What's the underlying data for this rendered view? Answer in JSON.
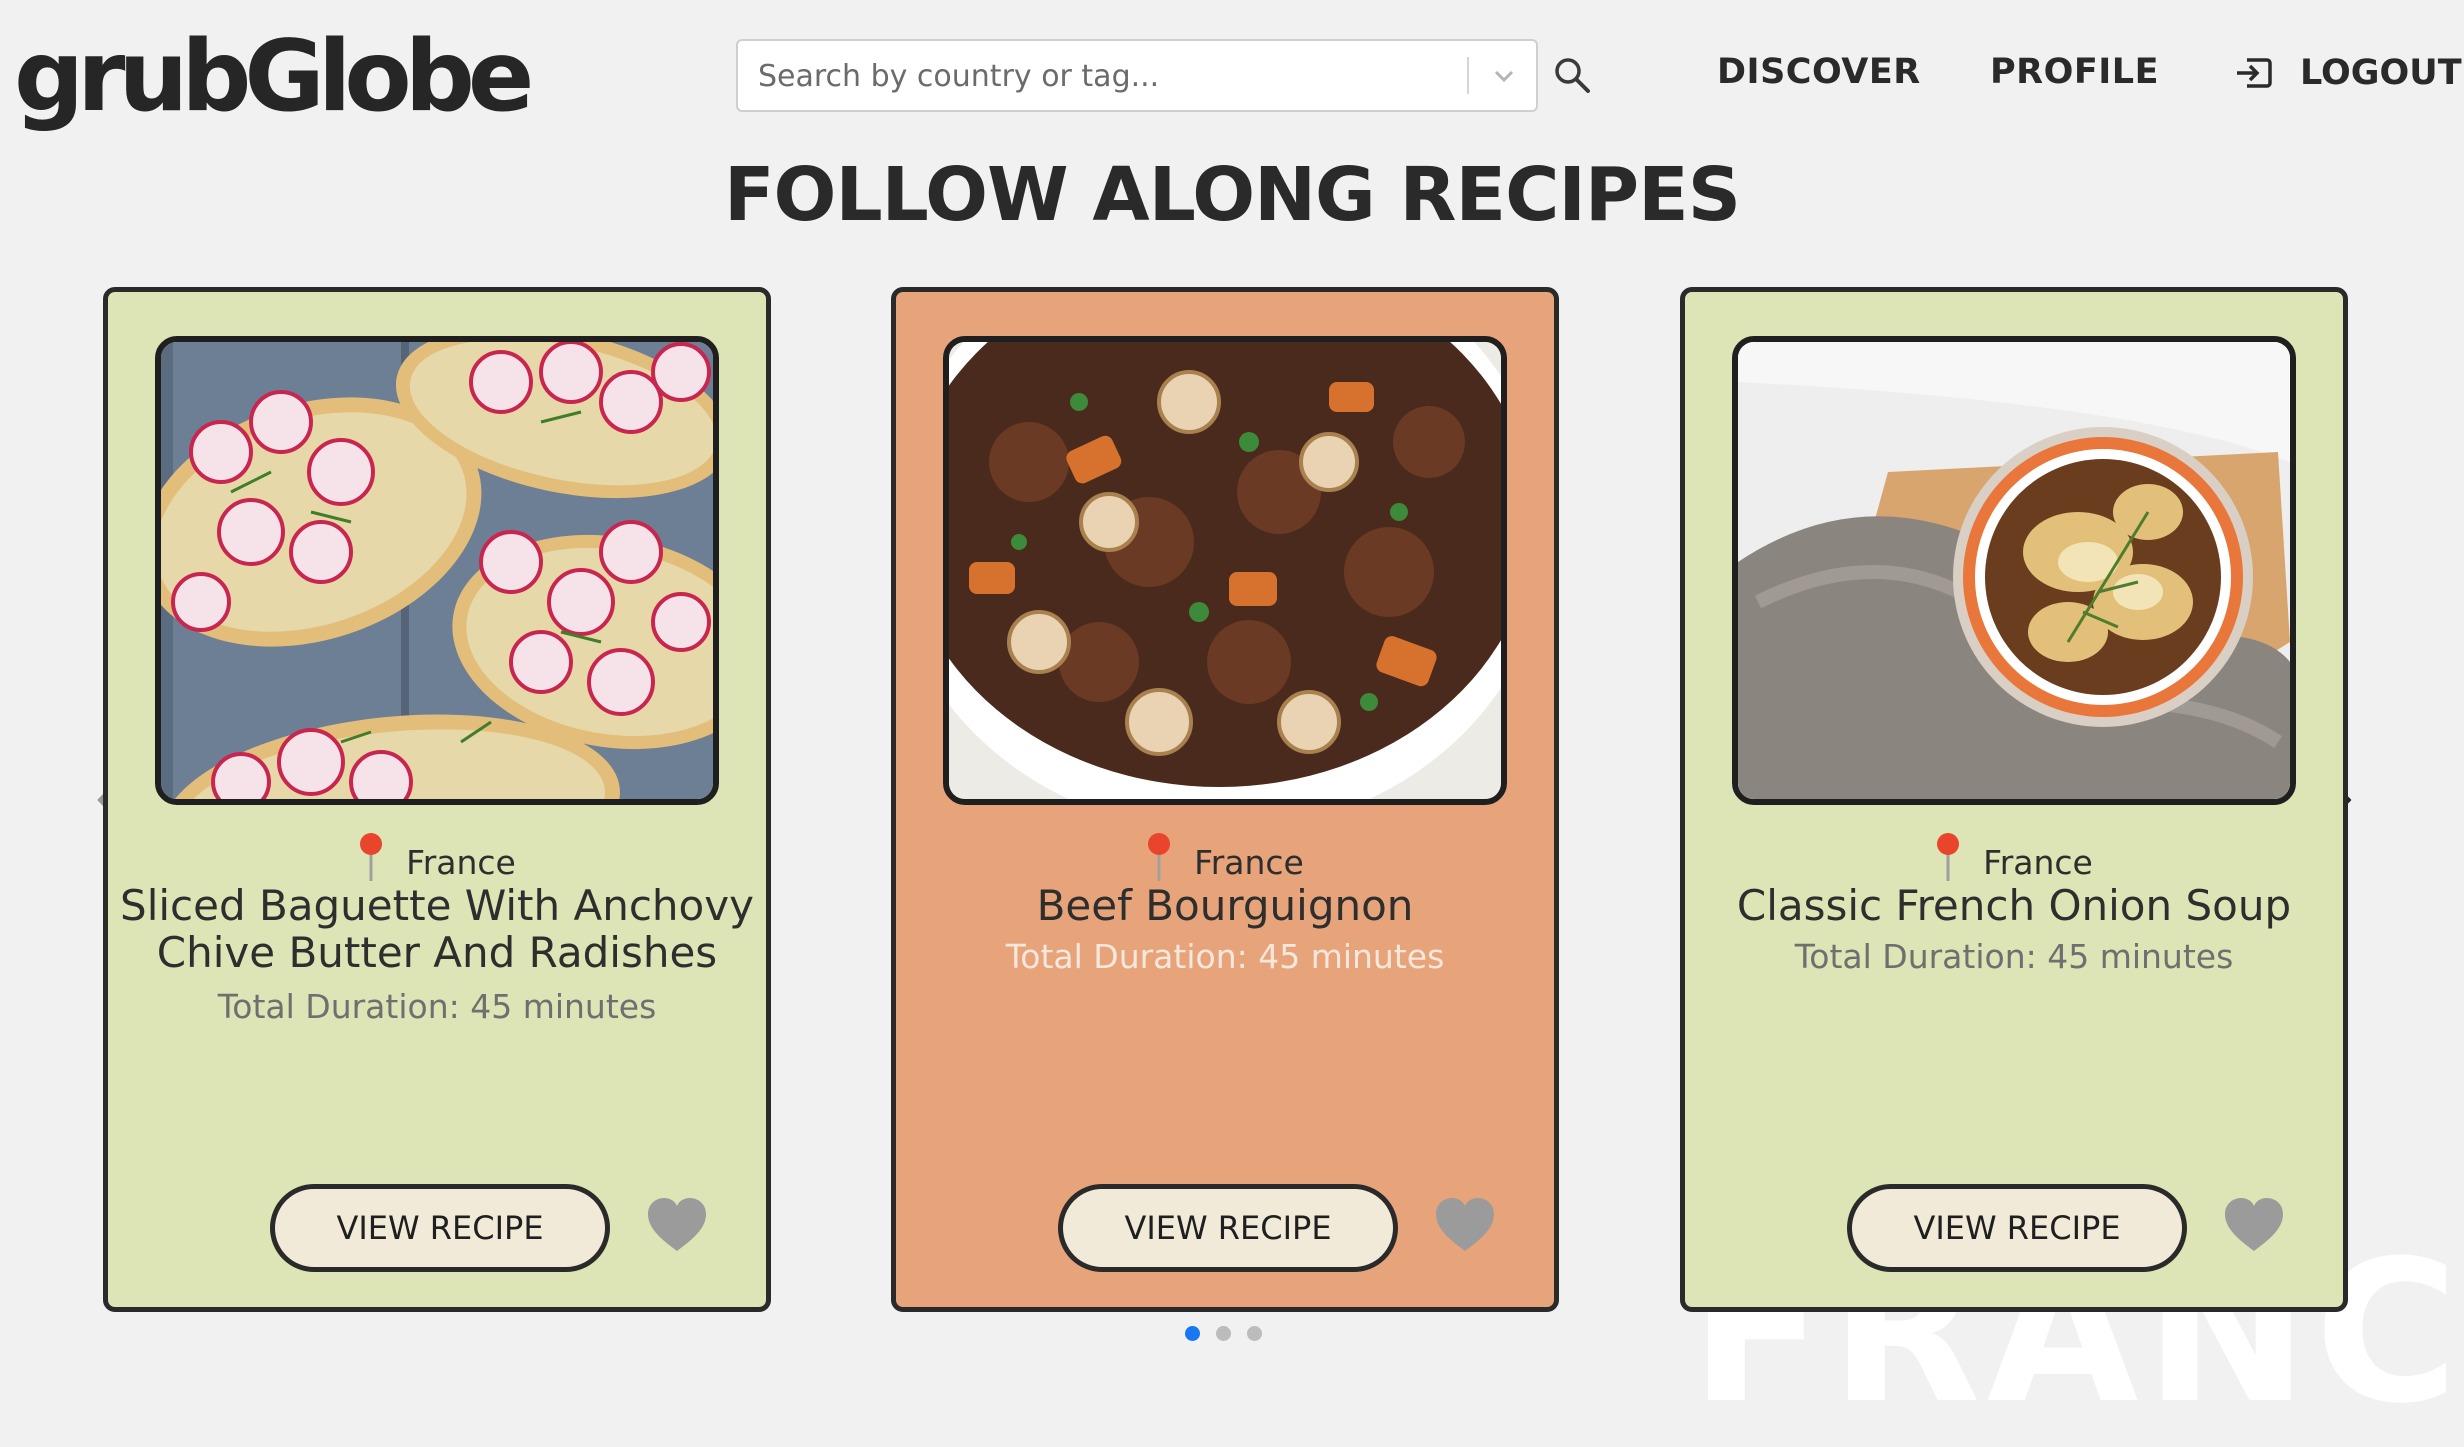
{
  "header": {
    "logo": "grubGlobe",
    "search_placeholder": "Search by country or tag...",
    "search_icon": "search-icon",
    "dropdown_icon": "chevron-down-icon",
    "nav": {
      "discover": "DISCOVER",
      "profile": "PROFILE",
      "logout": "LOGOUT",
      "logout_icon": "logout-icon"
    }
  },
  "page_title": "FOLLOW ALONG RECIPES",
  "carousel": {
    "prev_icon": "chevron-left-icon",
    "next_icon": "chevron-right-icon",
    "cards": [
      {
        "country": "France",
        "title": "Sliced Baguette With Anchovy Chive Butter And Radishes",
        "duration": "Total Duration: 45 minutes",
        "button": "VIEW RECIPE",
        "background": "#dde4b5",
        "image": "radish-toast-photo"
      },
      {
        "country": "France",
        "title": "Beef Bourguignon",
        "duration": "Total Duration: 45 minutes",
        "button": "VIEW RECIPE",
        "background": "#e7a47b",
        "image": "beef-stew-photo"
      },
      {
        "country": "France",
        "title": "Classic French Onion Soup",
        "duration": "Total Duration: 45 minutes",
        "button": "VIEW RECIPE",
        "background": "#dde4b5",
        "image": "onion-soup-photo"
      }
    ],
    "pagination": {
      "pages": 3,
      "active": 1
    }
  },
  "background_watermark": "FRANCE",
  "colors": {
    "accent_dot": "#1877f2",
    "card_green": "#dde4b5",
    "card_orange": "#e7a47b",
    "border": "#2a2a2a",
    "pin_red": "#e8452c"
  }
}
